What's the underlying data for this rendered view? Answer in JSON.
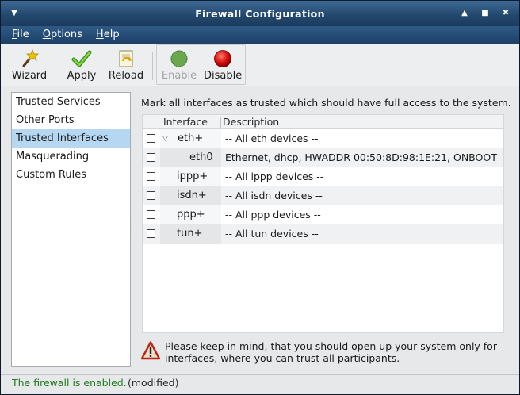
{
  "window": {
    "title": "Firewall Configuration"
  },
  "menu": {
    "items": [
      {
        "label": "File"
      },
      {
        "label": "Options"
      },
      {
        "label": "Help"
      }
    ]
  },
  "toolbar": {
    "items": [
      {
        "label": "Wizard",
        "icon": "wizard-wand-icon",
        "enabled": true
      },
      {
        "label": "Apply",
        "icon": "apply-checkmark-icon",
        "enabled": true
      },
      {
        "label": "Reload",
        "icon": "reload-icon",
        "enabled": true
      },
      {
        "label": "Enable",
        "icon": "enable-green-light-icon",
        "enabled": false
      },
      {
        "label": "Disable",
        "icon": "disable-red-light-icon",
        "enabled": true
      }
    ]
  },
  "sidebar": {
    "items": [
      {
        "label": "Trusted Services",
        "selected": false
      },
      {
        "label": "Other Ports",
        "selected": false
      },
      {
        "label": "Trusted Interfaces",
        "selected": true
      },
      {
        "label": "Masquerading",
        "selected": false
      },
      {
        "label": "Custom Rules",
        "selected": false
      }
    ]
  },
  "main": {
    "description": "Mark all interfaces as trusted which should have full access to the system.",
    "table": {
      "columns": [
        "Interface",
        "Description"
      ],
      "rows": [
        {
          "interface": "eth+",
          "description": "-- All eth devices --",
          "checked": false,
          "expanded": true
        },
        {
          "interface": "eth0",
          "description": "Ethernet, dhcp, HWADDR 00:50:8D:98:1E:21, ONBOOT",
          "checked": false,
          "child": true
        },
        {
          "interface": "ippp+",
          "description": "-- All ippp devices --",
          "checked": false
        },
        {
          "interface": "isdn+",
          "description": "-- All isdn devices --",
          "checked": false
        },
        {
          "interface": "ppp+",
          "description": "-- All ppp devices --",
          "checked": false
        },
        {
          "interface": "tun+",
          "description": "-- All tun devices --",
          "checked": false
        }
      ]
    },
    "warning": "Please keep in mind, that you should open up your system only for interfaces, where you can trust all participants."
  },
  "status": {
    "text": "The firewall is enabled.",
    "modified": "(modified)"
  },
  "colors": {
    "titlebar": "#24496f",
    "selection": "#b5d7f1",
    "status_ok": "#1f7a1f"
  }
}
